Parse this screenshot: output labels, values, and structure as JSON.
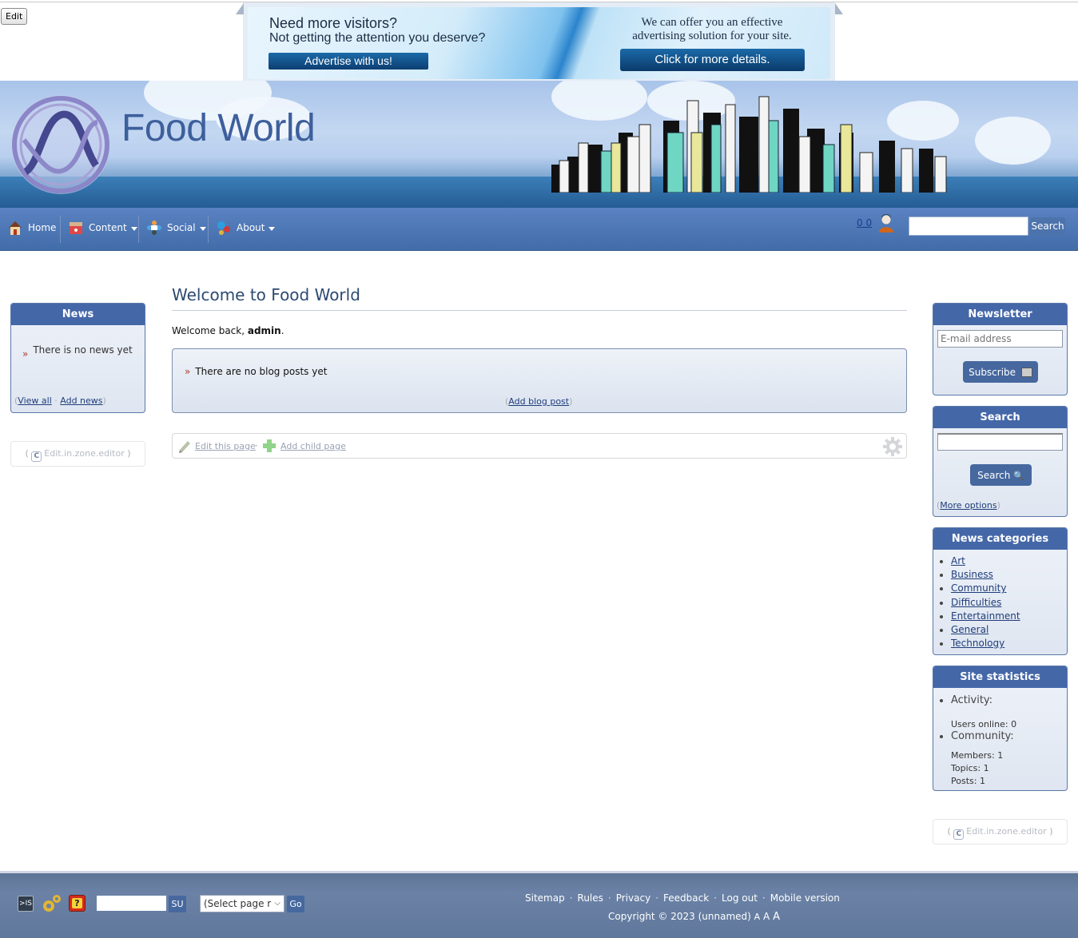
{
  "edit_button": "Edit",
  "ad": {
    "line1": "Need more visitors?",
    "line2": "Not getting the attention you deserve?",
    "cta_left": "Advertise with us!",
    "right_text_1": "We can offer you an effective",
    "right_text_2": "advertising solution for your site.",
    "cta_right": "Click for more details."
  },
  "header": {
    "site_title": "Food World",
    "logo_icon": "wave-circle-logo-icon"
  },
  "nav": {
    "items": [
      {
        "label": "Home",
        "icon": "house-icon",
        "dropdown": false
      },
      {
        "label": "Content",
        "icon": "toolbox-icon",
        "dropdown": true
      },
      {
        "label": "Social",
        "icon": "people-icon",
        "dropdown": true
      },
      {
        "label": "About",
        "icon": "gears-icon",
        "dropdown": true
      }
    ],
    "counters": "0 0",
    "search_value": "",
    "search_button": "Search"
  },
  "news_box": {
    "title": "News",
    "empty_text": "There is no news yet",
    "view_all": "View all",
    "add_news": "Add news"
  },
  "zone_editor_label": "Edit.in.zone.editor",
  "main": {
    "title": "Welcome to Food World",
    "welcome_prefix": "Welcome back, ",
    "username": "admin",
    "welcome_suffix": ".",
    "blog_empty": "There are no blog posts yet",
    "add_blog_post": "Add blog post",
    "edit_page": "Edit this page",
    "add_child_page": "Add child page"
  },
  "newsletter": {
    "title": "Newsletter",
    "email_placeholder": "E-mail address",
    "subscribe_button": "Subscribe"
  },
  "search_box": {
    "title": "Search",
    "input_value": "",
    "search_button": "Search",
    "more_options": "More options"
  },
  "news_categories": {
    "title": "News categories",
    "items": [
      "Art",
      "Business",
      "Community",
      "Difficulties",
      "Entertainment",
      "General",
      "Technology"
    ]
  },
  "site_statistics": {
    "title": "Site statistics",
    "activity_label": "Activity:",
    "users_online_label": "Users online:",
    "users_online": "0",
    "community_label": "Community:",
    "members_label": "Members:",
    "members": "1",
    "topics_label": "Topics:",
    "topics": "1",
    "posts_label": "Posts:",
    "posts": "1"
  },
  "footer": {
    "su_value": "",
    "su_button": "SU",
    "page_select": "(Select page r",
    "go_button": "Go",
    "links": [
      "Sitemap",
      "Rules",
      "Privacy",
      "Feedback",
      "Log out",
      "Mobile version"
    ],
    "copyright": "Copyright © 2023 (unnamed)",
    "font_sizes": [
      "A",
      "A",
      "A"
    ]
  },
  "colors": {
    "nav_bg": "#4d75b3",
    "box_header": "#4467a8",
    "link": "#1f3d7a",
    "footer_bg": "#667d a0"
  }
}
